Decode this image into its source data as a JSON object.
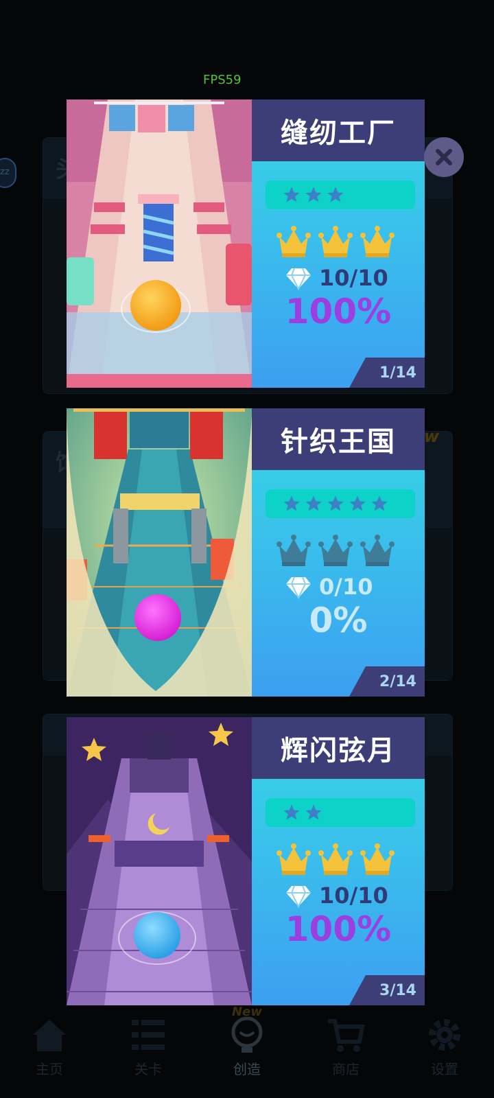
{
  "debug": {
    "fps": "FPS59"
  },
  "background": {
    "first_card_title": "头",
    "second_card_title": "饰",
    "new_badge": "New",
    "side_badge": "ZZ"
  },
  "bottom_nav": [
    {
      "label": "主页",
      "icon": "home-icon"
    },
    {
      "label": "关卡",
      "icon": "list-icon"
    },
    {
      "label": "创造",
      "icon": "lightbulb-icon",
      "badge": "New"
    },
    {
      "label": "商店",
      "icon": "cart-icon"
    },
    {
      "label": "设置",
      "icon": "gear-icon"
    }
  ],
  "close_button": {
    "icon": "close-icon"
  },
  "levels": [
    {
      "title": "缝纫工厂",
      "stars": 3,
      "crowns_earned": 3,
      "gems": "10/10",
      "percent": "100%",
      "page": "1/14",
      "ball_color": "#f7a823"
    },
    {
      "title": "针织王国",
      "stars": 5,
      "crowns_earned": 0,
      "gems": "0/10",
      "percent": "0%",
      "page": "2/14",
      "ball_color": "#e22fe0"
    },
    {
      "title": "辉闪弦月",
      "stars": 2,
      "crowns_earned": 3,
      "gems": "10/10",
      "percent": "100%",
      "page": "3/14",
      "ball_color": "#43b6ee"
    }
  ],
  "colors": {
    "star": "#3c80c8",
    "crown_gold": "#f5c33a",
    "crown_dim": "#3f7c98",
    "header": "#3d3e77"
  }
}
